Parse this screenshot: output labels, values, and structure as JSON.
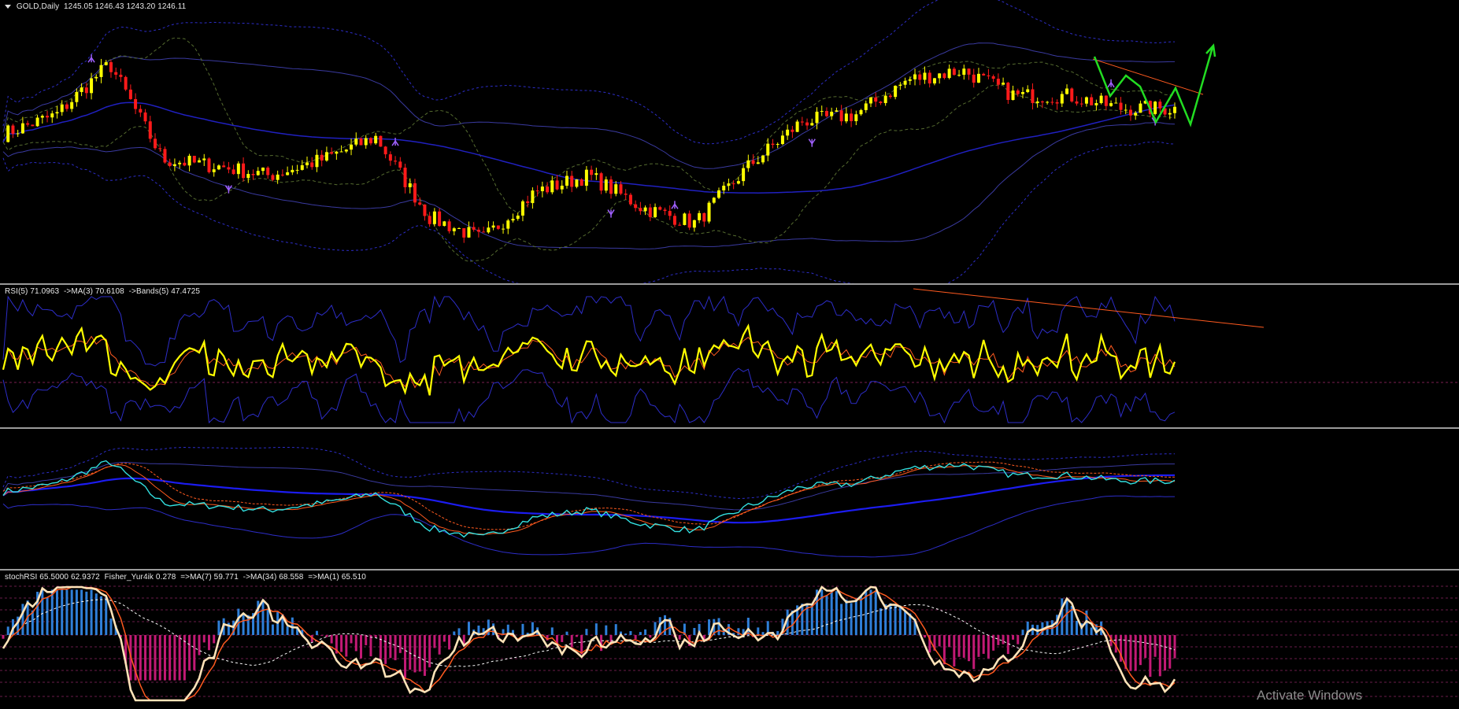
{
  "panes": [
    {
      "id": "price",
      "label_parts": [
        "GOLD,Daily",
        "1245.05 1246.43 1243.20 1246.11"
      ]
    },
    {
      "id": "rsi",
      "label_parts": [
        "RSI(5) 71.0963",
        "->MA(3) 70.6108",
        "->Bands(5) 47.4725"
      ]
    },
    {
      "id": "bands",
      "label_parts": []
    },
    {
      "id": "stoch",
      "label_parts": [
        "stochRSI 65.5000 62.9372",
        "Fisher_Yur4ik 0.278",
        "=>MA(7) 59.771",
        "->MA(34) 68.558",
        "=>MA(1) 65.510"
      ]
    }
  ],
  "watermark": "Activate Windows",
  "colors": {
    "background": "#000000",
    "bull_candle": "#ffff00",
    "bear_candle": "#ff1a1a",
    "band_blue": "#2d2dc8",
    "band_dark": "#3a3aa0",
    "rsi_line": "#ffff00",
    "ma_orange": "#ff5a1f",
    "cyan_line": "#33e0e0",
    "hist_up": "#2f7fd8",
    "hist_down": "#c21a75",
    "cream_line": "#ffe3b8",
    "zigzag": "#22dd22",
    "fractal": "#a060ff"
  },
  "chart_data": [
    {
      "type": "candlestick",
      "title": "GOLD,Daily",
      "ohlc_last": {
        "open": 1245.05,
        "high": 1246.43,
        "low": 1243.2,
        "close": 1246.11
      },
      "price_path": [
        0.58,
        0.64,
        0.8,
        0.5,
        0.48,
        0.45,
        0.5,
        0.57,
        0.32,
        0.25,
        0.4,
        0.45,
        0.35,
        0.3,
        0.48,
        0.62,
        0.64,
        0.75,
        0.78,
        0.7,
        0.7,
        0.66,
        0.66
      ],
      "fractal_markers": [
        "up",
        "down",
        "up",
        "down",
        "up",
        "down",
        "up",
        "down"
      ],
      "zigzag_projection": true
    },
    {
      "type": "line",
      "title": "RSI(5) 71.0963 ->MA(3) 70.6108 ->Bands(5) 47.4725",
      "series": [
        {
          "name": "RSI(5)",
          "last": 71.0963
        },
        {
          "name": "MA(3)",
          "last": 70.6108
        },
        {
          "name": "Bands(5)",
          "last": 47.4725
        }
      ],
      "trendline": "descending"
    },
    {
      "type": "line",
      "title": "",
      "series_count": 5
    },
    {
      "type": "area",
      "title": "stochRSI 65.5000 62.9372 Fisher_Yur4ik 0.278 =>MA(7) 59.771 ->MA(34) 68.558 =>MA(1) 65.510",
      "series": [
        {
          "name": "stochRSI",
          "values": [
            65.5,
            62.9372
          ]
        },
        {
          "name": "Fisher_Yur4ik",
          "last": 0.278
        },
        {
          "name": "MA(7)",
          "last": 59.771
        },
        {
          "name": "MA(34)",
          "last": 68.558
        },
        {
          "name": "MA(1)",
          "last": 65.51
        }
      ]
    }
  ]
}
